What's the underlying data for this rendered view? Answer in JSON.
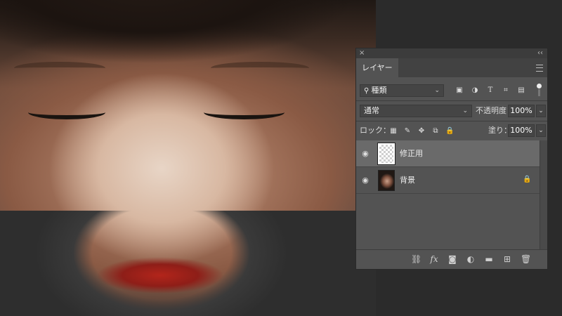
{
  "panel": {
    "title_close": "×",
    "collapse": "‹‹",
    "tab_label": "レイヤー",
    "filter": {
      "icon": "search-icon",
      "label": "種類",
      "chevron": "⌄"
    },
    "filter_icons": [
      "image-filter-icon",
      "adjustment-filter-icon",
      "type-filter-icon",
      "shape-filter-icon",
      "smart-object-filter-icon"
    ],
    "blend_mode": "通常",
    "opacity_label": "不透明度：",
    "opacity_value": "100%",
    "lock_label": "ロック：",
    "fill_label": "塗り：",
    "fill_value": "100%",
    "layers": [
      {
        "name": "修正用",
        "visible": true,
        "active": true,
        "thumbnail": "transparent"
      },
      {
        "name": "背景",
        "visible": true,
        "active": false,
        "thumbnail": "photo",
        "locked": true
      }
    ],
    "footer_icons": [
      "link-icon",
      "fx-icon",
      "mask-icon",
      "adjustment-icon",
      "folder-icon",
      "new-layer-icon",
      "trash-icon"
    ]
  },
  "glyphs": {
    "eye": "👁",
    "lock": "🔒",
    "fx": "fx",
    "T": "T"
  }
}
